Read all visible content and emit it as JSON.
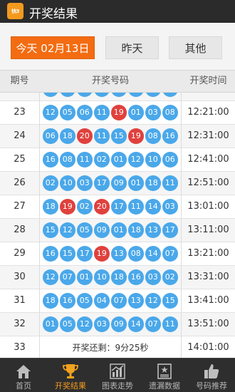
{
  "app": {
    "title": "开奖结果",
    "logo_text": "快3"
  },
  "filters": {
    "today": "今天  02月13日",
    "yesterday": "昨天",
    "other": "其他"
  },
  "table": {
    "headers": {
      "issue": "期号",
      "numbers": "开奖号码",
      "time": "开奖时间"
    },
    "rows": [
      {
        "issue": "23",
        "time": "12:21:00",
        "balls": [
          "12",
          "05",
          "06",
          "11",
          "19",
          "01",
          "03",
          "08"
        ],
        "red": [
          4
        ]
      },
      {
        "issue": "24",
        "time": "12:31:00",
        "balls": [
          "06",
          "18",
          "20",
          "11",
          "15",
          "19",
          "08",
          "16"
        ],
        "red": [
          2,
          5
        ]
      },
      {
        "issue": "25",
        "time": "12:41:00",
        "balls": [
          "16",
          "08",
          "11",
          "02",
          "01",
          "12",
          "10",
          "06"
        ],
        "red": []
      },
      {
        "issue": "26",
        "time": "12:51:00",
        "balls": [
          "02",
          "10",
          "03",
          "17",
          "09",
          "01",
          "18",
          "11"
        ],
        "red": []
      },
      {
        "issue": "27",
        "time": "13:01:00",
        "balls": [
          "18",
          "19",
          "02",
          "20",
          "17",
          "11",
          "14",
          "03"
        ],
        "red": [
          1,
          3
        ]
      },
      {
        "issue": "28",
        "time": "13:11:00",
        "balls": [
          "15",
          "12",
          "05",
          "09",
          "01",
          "18",
          "13",
          "17"
        ],
        "red": []
      },
      {
        "issue": "29",
        "time": "13:21:00",
        "balls": [
          "16",
          "15",
          "17",
          "19",
          "13",
          "08",
          "14",
          "07"
        ],
        "red": [
          3
        ]
      },
      {
        "issue": "30",
        "time": "13:31:00",
        "balls": [
          "12",
          "07",
          "01",
          "10",
          "18",
          "16",
          "03",
          "02"
        ],
        "red": []
      },
      {
        "issue": "31",
        "time": "13:41:00",
        "balls": [
          "18",
          "16",
          "05",
          "04",
          "07",
          "13",
          "12",
          "15"
        ],
        "red": []
      },
      {
        "issue": "32",
        "time": "13:51:00",
        "balls": [
          "01",
          "05",
          "12",
          "03",
          "09",
          "14",
          "07",
          "11"
        ],
        "red": []
      }
    ],
    "pending": {
      "issue": "33",
      "time": "14:01:00",
      "countdown": "开奖还剩：9分25秒"
    }
  },
  "tabbar": [
    {
      "label": "首页",
      "icon": "home-icon",
      "active": false
    },
    {
      "label": "开奖结果",
      "icon": "trophy-icon",
      "active": true
    },
    {
      "label": "图表走势",
      "icon": "trend-chart-icon",
      "active": false
    },
    {
      "label": "遗漏数据",
      "icon": "data-board-icon",
      "active": false
    },
    {
      "label": "号码推荐",
      "icon": "thumbs-up-icon",
      "active": false
    }
  ],
  "colors": {
    "accent": "#f36c12",
    "ball_blue": "#4aa8ea",
    "ball_red": "#e0413d",
    "tab_active": "#f39a1e"
  }
}
